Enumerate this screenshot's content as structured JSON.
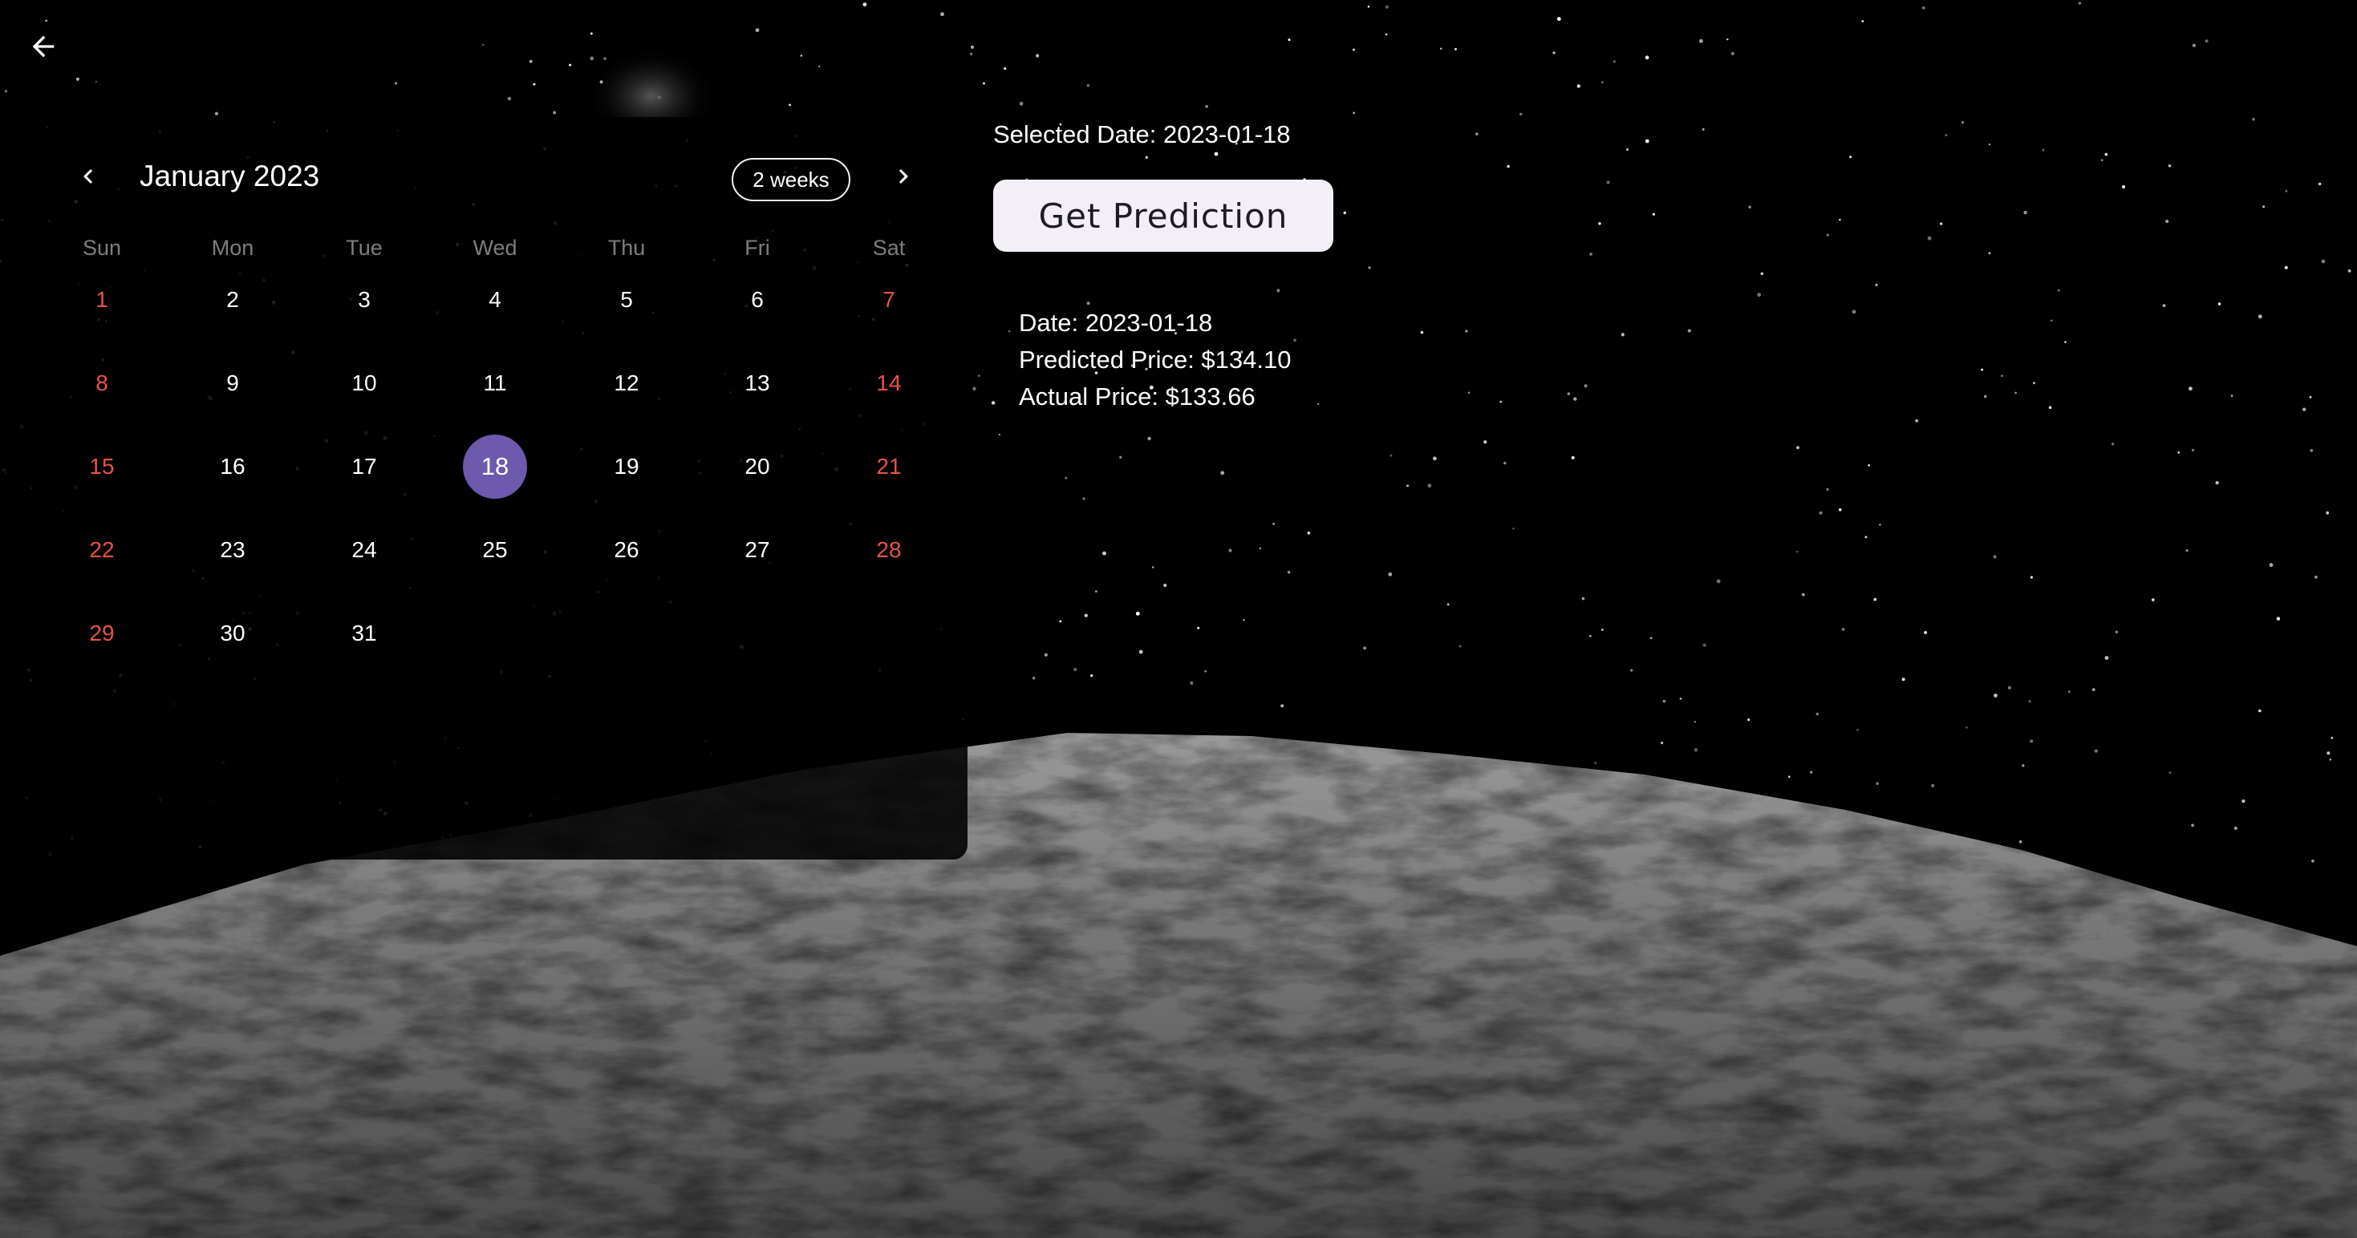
{
  "nav": {
    "back_icon": "arrow-left-icon"
  },
  "calendar": {
    "month_title": "January 2023",
    "format_button": "2 weeks",
    "prev_icon": "chevron-left-icon",
    "next_icon": "chevron-right-icon",
    "weekdays": [
      "Sun",
      "Mon",
      "Tue",
      "Wed",
      "Thu",
      "Fri",
      "Sat"
    ],
    "weeks": [
      [
        "1",
        "2",
        "3",
        "4",
        "5",
        "6",
        "7"
      ],
      [
        "8",
        "9",
        "10",
        "11",
        "12",
        "13",
        "14"
      ],
      [
        "15",
        "16",
        "17",
        "18",
        "19",
        "20",
        "21"
      ],
      [
        "22",
        "23",
        "24",
        "25",
        "26",
        "27",
        "28"
      ],
      [
        "29",
        "30",
        "31",
        "",
        "",
        "",
        ""
      ]
    ],
    "selected_day": "18",
    "colors": {
      "weekend": "#e5534b",
      "selected": "#6d5aae",
      "weekday_header": "#7d7d7d"
    }
  },
  "selection": {
    "label": "Selected Date: 2023-01-18"
  },
  "actions": {
    "predict_label": "Get Prediction"
  },
  "results": {
    "date_line": "Date: 2023-01-18",
    "predicted_line": "Predicted Price: $134.10",
    "actual_line": "Actual Price: $133.66"
  }
}
